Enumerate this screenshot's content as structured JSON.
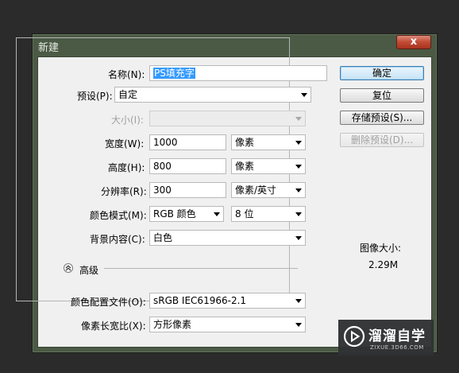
{
  "window": {
    "title": "新建",
    "close_label": "x"
  },
  "form": {
    "name_label": "名称(N):",
    "name_value": "PS填充字",
    "preset_label": "预设(P):",
    "preset_value": "自定",
    "size_label": "大小(I):",
    "size_value": "",
    "width_label": "宽度(W):",
    "width_value": "1000",
    "width_unit": "像素",
    "height_label": "高度(H):",
    "height_value": "800",
    "height_unit": "像素",
    "resolution_label": "分辨率(R):",
    "resolution_value": "300",
    "resolution_unit": "像素/英寸",
    "color_mode_label": "颜色模式(M):",
    "color_mode_value": "RGB 颜色",
    "bit_depth_value": "8 位",
    "background_label": "背景内容(C):",
    "background_value": "白色",
    "advanced_label": "高级",
    "color_profile_label": "颜色配置文件(O):",
    "color_profile_value": "sRGB IEC61966-2.1",
    "pixel_aspect_label": "像素长宽比(X):",
    "pixel_aspect_value": "方形像素"
  },
  "buttons": {
    "ok": "确定",
    "reset": "复位",
    "save_preset": "存储预设(S)...",
    "delete_preset": "删除预设(D)..."
  },
  "image_size": {
    "label": "图像大小:",
    "value": "2.29M"
  },
  "watermark": {
    "title": "溜溜自学",
    "url": "ZIXUE.3D66.COM"
  }
}
